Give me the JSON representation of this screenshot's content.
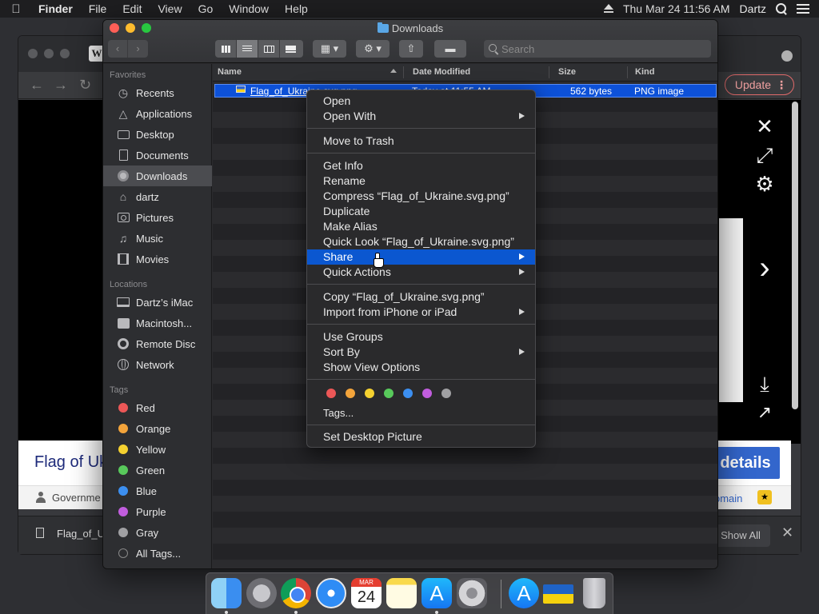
{
  "menubar": {
    "app_name": "Finder",
    "items": [
      "File",
      "Edit",
      "View",
      "Go",
      "Window",
      "Help"
    ],
    "clock": "Thu Mar 24  11:56 AM",
    "user": "Dartz"
  },
  "browser": {
    "tab_letter": "W",
    "update_label": "Update",
    "page_title_partial": "Flag of Uk",
    "more_details_partial": "details",
    "government_partial": "Governme",
    "domain_partial": "omain",
    "download_name_partial": "Flag_of_U",
    "show_all": "Show All"
  },
  "finder": {
    "title": "Downloads",
    "search_placeholder": "Search",
    "columns": {
      "name": "Name",
      "date": "Date Modified",
      "size": "Size",
      "kind": "Kind"
    },
    "selected_file": {
      "name": "Flag_of_Ukraine.svg.png",
      "date": "Today at 11:55 AM",
      "size": "562 bytes",
      "kind": "PNG image"
    },
    "sidebar": {
      "favorites_title": "Favorites",
      "favorites": [
        "Recents",
        "Applications",
        "Desktop",
        "Documents",
        "Downloads",
        "dartz",
        "Pictures",
        "Music",
        "Movies"
      ],
      "locations_title": "Locations",
      "locations": [
        "Dartz’s iMac",
        "Macintosh...",
        "Remote Disc",
        "Network"
      ],
      "tags_title": "Tags",
      "tags": [
        "Red",
        "Orange",
        "Yellow",
        "Green",
        "Blue",
        "Purple",
        "Gray",
        "All Tags..."
      ]
    }
  },
  "context_menu": {
    "items": [
      "Open",
      "Open With",
      "Move to Trash",
      "Get Info",
      "Rename",
      "Compress “Flag_of_Ukraine.svg.png”",
      "Duplicate",
      "Make Alias",
      "Quick Look “Flag_of_Ukraine.svg.png”",
      "Share",
      "Quick Actions",
      "Copy “Flag_of_Ukraine.svg.png”",
      "Import from iPhone or iPad",
      "Use Groups",
      "Sort By",
      "Show View Options",
      "Tags...",
      "Set Desktop Picture"
    ],
    "highlighted": "Share"
  },
  "colors": {
    "tag_red": "#ec5757",
    "tag_orange": "#f3a43b",
    "tag_yellow": "#f5d130",
    "tag_green": "#58c95b",
    "tag_blue": "#3c8ff0",
    "tag_purple": "#c15dde",
    "tag_gray": "#a0a0a3",
    "selection": "#0b57d0"
  },
  "dock": {
    "calendar_month": "MAR",
    "calendar_day": "24"
  }
}
